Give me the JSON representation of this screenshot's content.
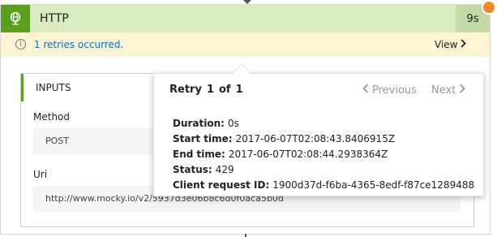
{
  "header": {
    "title": "HTTP",
    "duration": "9s",
    "icon": "globe-icon",
    "accent": "#5a9e1e",
    "background": "#d9ebc3"
  },
  "retry_banner": {
    "message": "1 retries occurred.",
    "view_label": "View",
    "background": "#fcf3d2",
    "link_color": "#0f6ec2"
  },
  "inputs": {
    "title": "INPUTS",
    "fields": [
      {
        "label": "Method",
        "value": "POST"
      },
      {
        "label": "Uri",
        "value": "http://www.mocky.io/v2/5937d3e06b8c6d0f0aca5b0d"
      }
    ]
  },
  "popover": {
    "title_prefix": "Retry",
    "current": "1",
    "separator": "of",
    "total": "1",
    "previous_label": "Previous",
    "next_label": "Next",
    "details": [
      {
        "label": "Duration:",
        "value": "0s"
      },
      {
        "label": "Start time:",
        "value": "2017-06-07T02:08:43.8406915Z"
      },
      {
        "label": "End time:",
        "value": "2017-06-07T02:08:44.2938364Z"
      },
      {
        "label": "Status:",
        "value": "429"
      },
      {
        "label": "Client request ID:",
        "value": "1900d37d-f6ba-4365-8edf-f87ce1289488"
      }
    ]
  }
}
